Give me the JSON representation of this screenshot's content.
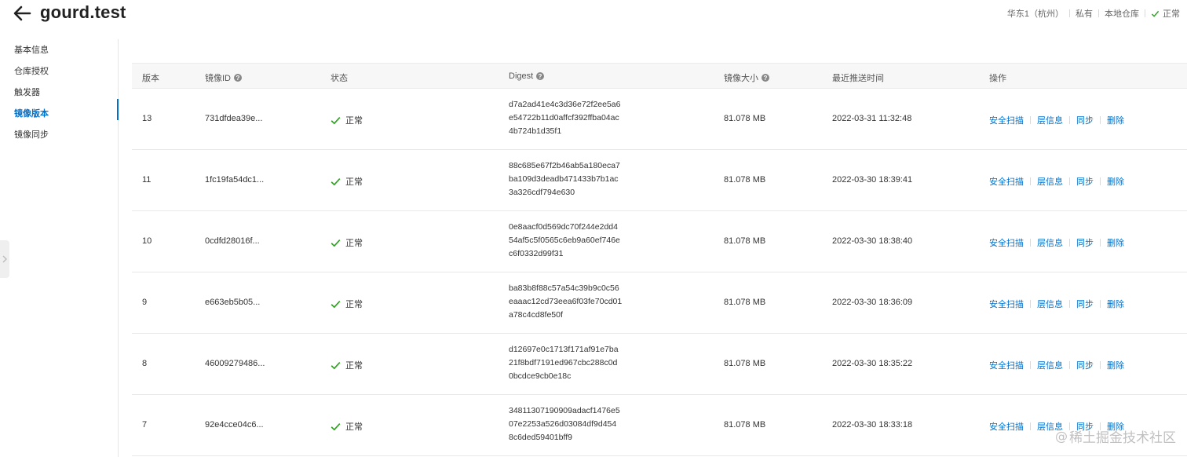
{
  "header": {
    "title": "gourd.test",
    "region": "华东1（杭州）",
    "visibility": "私有",
    "repo_type": "本地仓库",
    "status": "正常"
  },
  "sidebar": {
    "items": [
      {
        "label": "基本信息"
      },
      {
        "label": "仓库授权"
      },
      {
        "label": "触发器"
      },
      {
        "label": "镜像版本"
      },
      {
        "label": "镜像同步"
      }
    ],
    "active_index": 3
  },
  "table": {
    "headers": {
      "version": "版本",
      "image_id": "镜像ID",
      "status": "状态",
      "digest": "Digest",
      "size": "镜像大小",
      "push_time": "最近推送时间",
      "actions": "操作"
    },
    "action_labels": [
      "安全扫描",
      "层信息",
      "同步",
      "删除"
    ],
    "rows": [
      {
        "version": "13",
        "image_id": "731dfdea39e...",
        "status": "正常",
        "digest": [
          "d7a2ad41e4c3d36e72f2ee5a6",
          "e54722b11d0affcf392ffba04ac",
          "4b724b1d35f1"
        ],
        "size": "81.078 MB",
        "push_time": "2022-03-31 11:32:48"
      },
      {
        "version": "11",
        "image_id": "1fc19fa54dc1...",
        "status": "正常",
        "digest": [
          "88c685e67f2b46ab5a180eca7",
          "ba109d3deadb471433b7b1ac",
          "3a326cdf794e630"
        ],
        "size": "81.078 MB",
        "push_time": "2022-03-30 18:39:41"
      },
      {
        "version": "10",
        "image_id": "0cdfd28016f...",
        "status": "正常",
        "digest": [
          "0e8aacf0d569dc70f244e2dd4",
          "54af5c5f0565c6eb9a60ef746e",
          "c6f0332d99f31"
        ],
        "size": "81.078 MB",
        "push_time": "2022-03-30 18:38:40"
      },
      {
        "version": "9",
        "image_id": "e663eb5b05...",
        "status": "正常",
        "digest": [
          "ba83b8f88c57a54c39b9c0c56",
          "eaaac12cd73eea6f03fe70cd01",
          "a78c4cd8fe50f"
        ],
        "size": "81.078 MB",
        "push_time": "2022-03-30 18:36:09"
      },
      {
        "version": "8",
        "image_id": "46009279486...",
        "status": "正常",
        "digest": [
          "d12697e0c1713f171af91e7ba",
          "21f8bdf7191ed967cbc288c0d",
          "0bcdce9cb0e18c"
        ],
        "size": "81.078 MB",
        "push_time": "2022-03-30 18:35:22"
      },
      {
        "version": "7",
        "image_id": "92e4cce04c6...",
        "status": "正常",
        "digest": [
          "34811307190909adacf1476e5",
          "07e2253a526d03084df9d454",
          "8c6ded59401bff9"
        ],
        "size": "81.078 MB",
        "push_time": "2022-03-30 18:33:18"
      }
    ]
  },
  "watermark": {
    "at": "@",
    "text": "稀土掘金技术社区"
  },
  "colors": {
    "accent": "#0070cc",
    "success": "#2ea121"
  },
  "icons": [
    "back-arrow-icon",
    "check-icon",
    "help-circle-icon",
    "chevron-right-icon"
  ]
}
